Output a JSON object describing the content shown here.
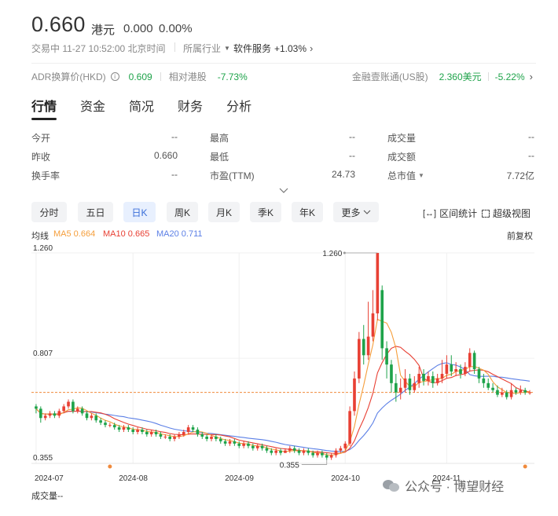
{
  "quote": {
    "price": "0.660",
    "currency": "港元",
    "change": "0.000",
    "change_pct": "0.00%",
    "status_line": "交易中 11-27 10:52:00 北京时间",
    "industry_label": "所属行业",
    "industry_name": "软件服务",
    "industry_change": "+1.03%"
  },
  "adr": {
    "label": "ADR换算价(HKD)",
    "value": "0.609",
    "rel_label": "相对港股",
    "rel_value": "-7.73%",
    "acct_label": "金融壹账通(US股)",
    "acct_price": "2.360美元",
    "acct_change": "-5.22%"
  },
  "tabs": [
    "行情",
    "资金",
    "简况",
    "财务",
    "分析"
  ],
  "stats": {
    "col1": [
      {
        "label": "今开",
        "value": "--"
      },
      {
        "label": "昨收",
        "value": "0.660"
      },
      {
        "label": "换手率",
        "value": "--"
      }
    ],
    "col2": [
      {
        "label": "最高",
        "value": "--"
      },
      {
        "label": "最低",
        "value": "--"
      },
      {
        "label": "市盈(TTM)",
        "value": "24.73"
      }
    ],
    "col3": [
      {
        "label": "成交量",
        "value": "--"
      },
      {
        "label": "成交额",
        "value": "--"
      },
      {
        "label": "总市值",
        "value": "7.72亿"
      }
    ]
  },
  "periods": [
    "分时",
    "五日",
    "日K",
    "周K",
    "月K",
    "季K",
    "年K",
    "更多"
  ],
  "active_period": "日K",
  "tools": {
    "range_stats": "区间统计",
    "super_view": "超级视图",
    "adjust": "前复权"
  },
  "ma": {
    "title": "均线",
    "ma5": "MA5 0.664",
    "ma10": "MA10 0.665",
    "ma20": "MA20 0.711"
  },
  "colors": {
    "up": "#e84034",
    "down": "#1ea34a",
    "ma5": "#f59e3b",
    "ma10": "#e84034",
    "ma20": "#5b7fe6",
    "ref": "#f08a3c"
  },
  "chart_data": {
    "type": "candlestick",
    "y_ticks": [
      "1.260",
      "0.807",
      "0.355"
    ],
    "ylim": [
      0.355,
      1.26
    ],
    "x_ticks": [
      "2024-07",
      "2024-08",
      "2024-09",
      "2024-10",
      "2024-11"
    ],
    "high_marker": "1.260",
    "low_marker": "0.355",
    "ref_price": 0.66,
    "candles": [
      [
        0.6,
        0.59,
        0.61,
        0.57
      ],
      [
        0.59,
        0.55,
        0.6,
        0.53
      ],
      [
        0.55,
        0.56,
        0.57,
        0.54
      ],
      [
        0.56,
        0.57,
        0.58,
        0.55
      ],
      [
        0.57,
        0.56,
        0.58,
        0.55
      ],
      [
        0.56,
        0.58,
        0.59,
        0.55
      ],
      [
        0.58,
        0.6,
        0.61,
        0.57
      ],
      [
        0.6,
        0.62,
        0.63,
        0.59
      ],
      [
        0.62,
        0.58,
        0.63,
        0.57
      ],
      [
        0.58,
        0.59,
        0.6,
        0.57
      ],
      [
        0.59,
        0.57,
        0.6,
        0.56
      ],
      [
        0.57,
        0.55,
        0.58,
        0.54
      ],
      [
        0.55,
        0.56,
        0.57,
        0.54
      ],
      [
        0.56,
        0.54,
        0.57,
        0.53
      ],
      [
        0.54,
        0.53,
        0.55,
        0.52
      ],
      [
        0.53,
        0.52,
        0.54,
        0.51
      ],
      [
        0.52,
        0.52,
        0.53,
        0.51
      ],
      [
        0.52,
        0.51,
        0.53,
        0.5
      ],
      [
        0.51,
        0.5,
        0.52,
        0.49
      ],
      [
        0.5,
        0.51,
        0.52,
        0.49
      ],
      [
        0.51,
        0.5,
        0.52,
        0.49
      ],
      [
        0.5,
        0.49,
        0.51,
        0.48
      ],
      [
        0.49,
        0.5,
        0.51,
        0.48
      ],
      [
        0.5,
        0.49,
        0.51,
        0.48
      ],
      [
        0.49,
        0.48,
        0.5,
        0.47
      ],
      [
        0.48,
        0.49,
        0.5,
        0.47
      ],
      [
        0.49,
        0.48,
        0.5,
        0.47
      ],
      [
        0.48,
        0.47,
        0.49,
        0.46
      ],
      [
        0.47,
        0.47,
        0.48,
        0.46
      ],
      [
        0.47,
        0.46,
        0.48,
        0.45
      ],
      [
        0.46,
        0.47,
        0.48,
        0.45
      ],
      [
        0.47,
        0.48,
        0.49,
        0.46
      ],
      [
        0.48,
        0.49,
        0.5,
        0.47
      ],
      [
        0.49,
        0.51,
        0.52,
        0.48
      ],
      [
        0.51,
        0.5,
        0.52,
        0.49
      ],
      [
        0.5,
        0.48,
        0.51,
        0.47
      ],
      [
        0.48,
        0.47,
        0.49,
        0.46
      ],
      [
        0.47,
        0.46,
        0.48,
        0.45
      ],
      [
        0.46,
        0.47,
        0.48,
        0.45
      ],
      [
        0.47,
        0.46,
        0.48,
        0.45
      ],
      [
        0.46,
        0.45,
        0.47,
        0.44
      ],
      [
        0.45,
        0.44,
        0.46,
        0.43
      ],
      [
        0.44,
        0.45,
        0.46,
        0.43
      ],
      [
        0.45,
        0.44,
        0.46,
        0.43
      ],
      [
        0.44,
        0.43,
        0.45,
        0.42
      ],
      [
        0.43,
        0.44,
        0.45,
        0.42
      ],
      [
        0.44,
        0.43,
        0.45,
        0.42
      ],
      [
        0.43,
        0.42,
        0.44,
        0.41
      ],
      [
        0.42,
        0.43,
        0.44,
        0.41
      ],
      [
        0.43,
        0.42,
        0.44,
        0.41
      ],
      [
        0.42,
        0.41,
        0.43,
        0.4
      ],
      [
        0.41,
        0.4,
        0.42,
        0.39
      ],
      [
        0.4,
        0.41,
        0.42,
        0.39
      ],
      [
        0.41,
        0.4,
        0.42,
        0.39
      ],
      [
        0.4,
        0.41,
        0.42,
        0.4
      ],
      [
        0.41,
        0.42,
        0.43,
        0.4
      ],
      [
        0.42,
        0.41,
        0.43,
        0.4
      ],
      [
        0.41,
        0.4,
        0.42,
        0.39
      ],
      [
        0.4,
        0.41,
        0.42,
        0.39
      ],
      [
        0.41,
        0.4,
        0.42,
        0.39
      ],
      [
        0.4,
        0.39,
        0.41,
        0.38
      ],
      [
        0.39,
        0.4,
        0.41,
        0.38
      ],
      [
        0.4,
        0.39,
        0.41,
        0.38
      ],
      [
        0.39,
        0.38,
        0.4,
        0.37
      ],
      [
        0.38,
        0.39,
        0.4,
        0.37
      ],
      [
        0.39,
        0.41,
        0.42,
        0.38
      ],
      [
        0.41,
        0.42,
        0.43,
        0.4
      ],
      [
        0.42,
        0.44,
        0.45,
        0.41
      ],
      [
        0.44,
        0.58,
        0.6,
        0.43
      ],
      [
        0.58,
        0.72,
        0.75,
        0.56
      ],
      [
        0.72,
        0.89,
        0.92,
        0.7
      ],
      [
        0.89,
        0.82,
        0.95,
        0.78
      ],
      [
        0.82,
        0.9,
        1.05,
        0.8
      ],
      [
        0.9,
        1.0,
        1.1,
        0.88
      ],
      [
        1.0,
        1.26,
        1.26,
        0.97
      ],
      [
        1.1,
        0.85,
        1.12,
        0.8
      ],
      [
        0.85,
        0.78,
        0.88,
        0.72
      ],
      [
        0.78,
        0.7,
        0.8,
        0.66
      ],
      [
        0.7,
        0.66,
        0.74,
        0.62
      ],
      [
        0.66,
        0.68,
        0.72,
        0.63
      ],
      [
        0.68,
        0.72,
        0.76,
        0.66
      ],
      [
        0.72,
        0.67,
        0.74,
        0.65
      ],
      [
        0.67,
        0.7,
        0.73,
        0.66
      ],
      [
        0.7,
        0.74,
        0.77,
        0.68
      ],
      [
        0.74,
        0.71,
        0.76,
        0.69
      ],
      [
        0.71,
        0.73,
        0.75,
        0.69
      ],
      [
        0.73,
        0.7,
        0.75,
        0.68
      ],
      [
        0.7,
        0.72,
        0.74,
        0.69
      ],
      [
        0.72,
        0.74,
        0.8,
        0.7
      ],
      [
        0.74,
        0.78,
        0.82,
        0.72
      ],
      [
        0.78,
        0.75,
        0.82,
        0.73
      ],
      [
        0.75,
        0.76,
        0.79,
        0.73
      ],
      [
        0.76,
        0.74,
        0.78,
        0.72
      ],
      [
        0.74,
        0.77,
        0.79,
        0.73
      ],
      [
        0.77,
        0.83,
        0.85,
        0.75
      ],
      [
        0.83,
        0.76,
        0.84,
        0.74
      ],
      [
        0.76,
        0.72,
        0.77,
        0.7
      ],
      [
        0.72,
        0.7,
        0.74,
        0.68
      ],
      [
        0.7,
        0.68,
        0.72,
        0.67
      ],
      [
        0.68,
        0.67,
        0.7,
        0.66
      ],
      [
        0.67,
        0.65,
        0.69,
        0.64
      ],
      [
        0.65,
        0.66,
        0.68,
        0.64
      ],
      [
        0.66,
        0.64,
        0.67,
        0.63
      ],
      [
        0.64,
        0.67,
        0.7,
        0.63
      ],
      [
        0.67,
        0.66,
        0.68,
        0.65
      ],
      [
        0.66,
        0.67,
        0.69,
        0.65
      ],
      [
        0.67,
        0.66,
        0.68,
        0.65
      ],
      [
        0.66,
        0.66,
        0.67,
        0.65
      ]
    ]
  },
  "volume_label": "成交量--",
  "watermark": "公众号 · 博望财经"
}
